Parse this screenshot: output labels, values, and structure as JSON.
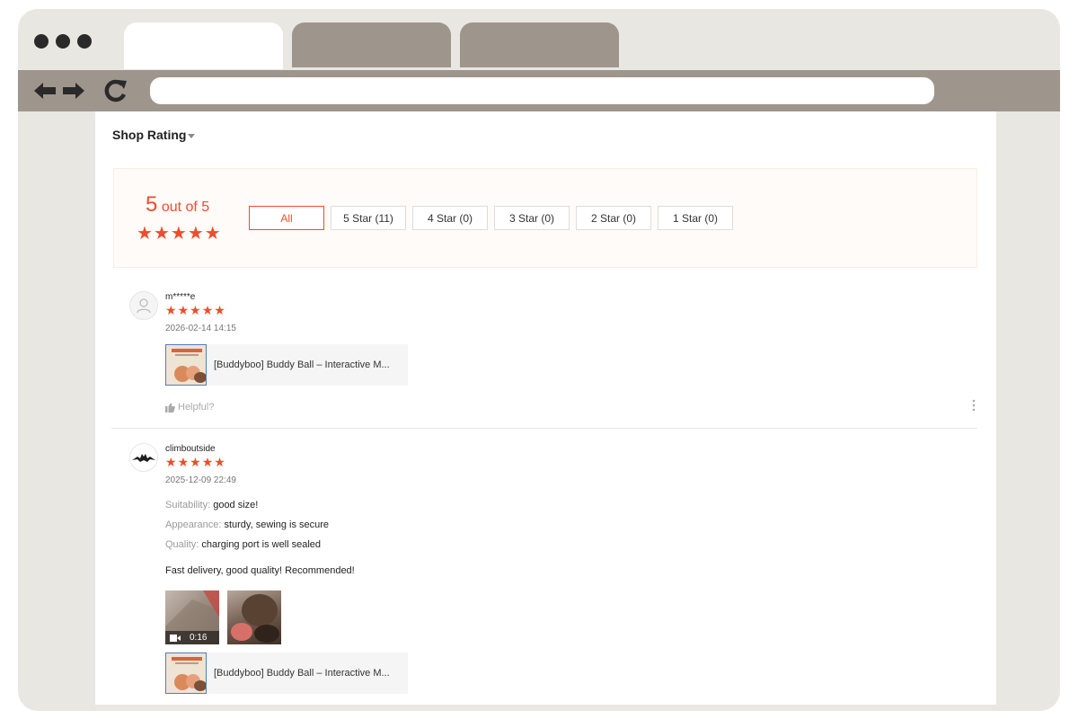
{
  "browser": {
    "address_value": "",
    "back_glyph": "🡐",
    "forward_glyph": "🡒",
    "reload_glyph": "↻"
  },
  "section": {
    "title": "Shop Rating"
  },
  "summary": {
    "score": "5",
    "score_suffix": "out of 5",
    "stars": 5,
    "filters": [
      "All",
      "5 Star (11)",
      "4 Star (0)",
      "3 Star (0)",
      "2 Star (0)",
      "1 Star (0)"
    ]
  },
  "reviews": [
    {
      "username": "m*****e",
      "stars": 5,
      "date": "2026-02-14 14:15",
      "product_name": "[Buddyboo] Buddy Ball – Interactive M...",
      "helpful_label": "Helpful?"
    },
    {
      "username": "climboutside",
      "stars": 5,
      "date": "2025-12-09 22:49",
      "attributes": [
        {
          "label": "Suitability:",
          "value": "good size!"
        },
        {
          "label": "Appearance:",
          "value": "sturdy, sewing is secure"
        },
        {
          "label": "Quality:",
          "value": "charging port is well sealed"
        }
      ],
      "comment": "Fast delivery, good quality! Recommended!",
      "video_duration": "0:16",
      "product_name": "[Buddyboo] Buddy Ball – Interactive M..."
    }
  ],
  "colors": {
    "accent": "#ee4d2d",
    "toolbar": "#9e958d",
    "window_frame": "#e8e7e2"
  },
  "icons": {
    "star": "star-icon",
    "thumbs_up": "thumbs-up-icon",
    "more": "more-vertical-icon",
    "video": "video-camera-icon"
  }
}
